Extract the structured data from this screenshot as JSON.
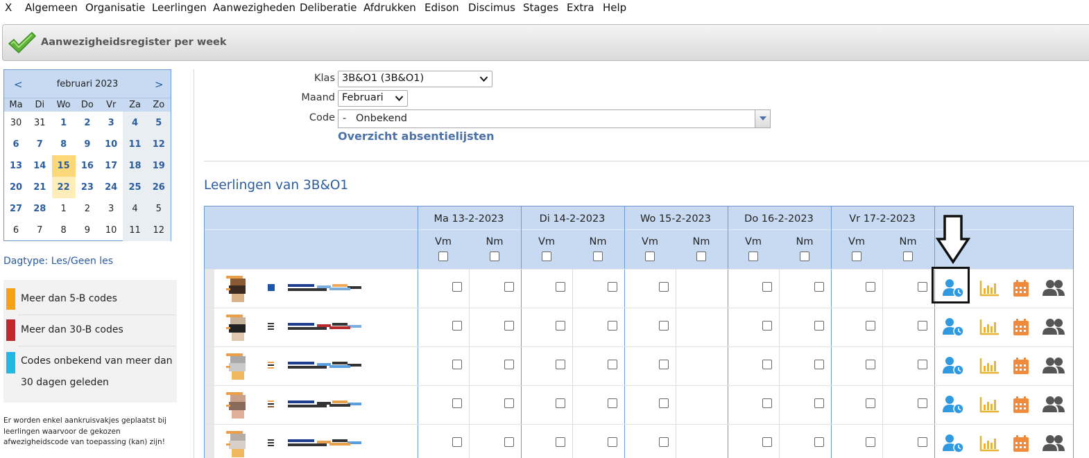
{
  "menu": [
    "X",
    "Algemeen",
    "Organisatie",
    "Leerlingen",
    "Aanwezigheden",
    "Deliberatie",
    "Afdrukken",
    "Edison",
    "Discimus",
    "Stages",
    "Extra",
    "Help"
  ],
  "page_title": "Aanwezigheidsregister per week",
  "calendar": {
    "prev": "<",
    "next": ">",
    "month_label": "februari 2023",
    "weekdays": [
      "Ma",
      "Di",
      "Wo",
      "Do",
      "Vr",
      "Za",
      "Zo"
    ],
    "weeks": [
      [
        30,
        31,
        1,
        2,
        3,
        4,
        5
      ],
      [
        6,
        7,
        8,
        9,
        10,
        11,
        12
      ],
      [
        13,
        14,
        15,
        16,
        17,
        18,
        19
      ],
      [
        20,
        21,
        22,
        23,
        24,
        25,
        26
      ],
      [
        27,
        28,
        1,
        2,
        3,
        4,
        5
      ],
      [
        6,
        7,
        8,
        9,
        10,
        11,
        12
      ]
    ],
    "today": 15,
    "selected": 22
  },
  "dagtype": "Dagtype: Les/Geen les",
  "legend": [
    {
      "label": "Meer dan 5-B codes",
      "color": "#f5a11a"
    },
    {
      "label": "Meer dan 30-B codes",
      "color": "#c0282d"
    },
    {
      "label_line1": "Codes onbekend van meer dan",
      "label_line2": "30 dagen geleden",
      "color": "#23b7e5"
    }
  ],
  "note": "Er worden enkel aankruisvakjes geplaatst bij leerlingen waarvoor de gekozen afwezigheidscode van toepassing (kan) zijn!",
  "form": {
    "klas_label": "Klas",
    "klas_value": "3B&O1 (3B&O1)",
    "maand_label": "Maand",
    "maand_value": "Februari",
    "code_label": "Code",
    "code_value": "-   Onbekend",
    "overzicht_link": "Overzicht absentielijsten"
  },
  "section_title": "Leerlingen van 3B&O1",
  "table": {
    "days": [
      "Ma 13-2-2023",
      "Di 14-2-2023",
      "Wo 15-2-2023",
      "Do 16-2-2023",
      "Vr 17-2-2023"
    ],
    "vm": "Vm",
    "nm": "Nm",
    "rows": [
      {
        "marker": "square-blue"
      },
      {
        "marker": "lines"
      },
      {
        "marker": "lines-orange"
      },
      {
        "marker": "lines-orange-dark"
      },
      {
        "marker": "lines"
      }
    ],
    "action_icons": [
      "user-clock-icon",
      "bar-chart-icon",
      "calendar-icon",
      "users-icon"
    ]
  },
  "colors": {
    "accent_blue": "#2a5c9e",
    "header_bg": "#c7daf1",
    "icon_blue": "#2f9ae0",
    "icon_yellow": "#e8b530",
    "icon_orange": "#f08a3c",
    "icon_gray": "#555555"
  }
}
